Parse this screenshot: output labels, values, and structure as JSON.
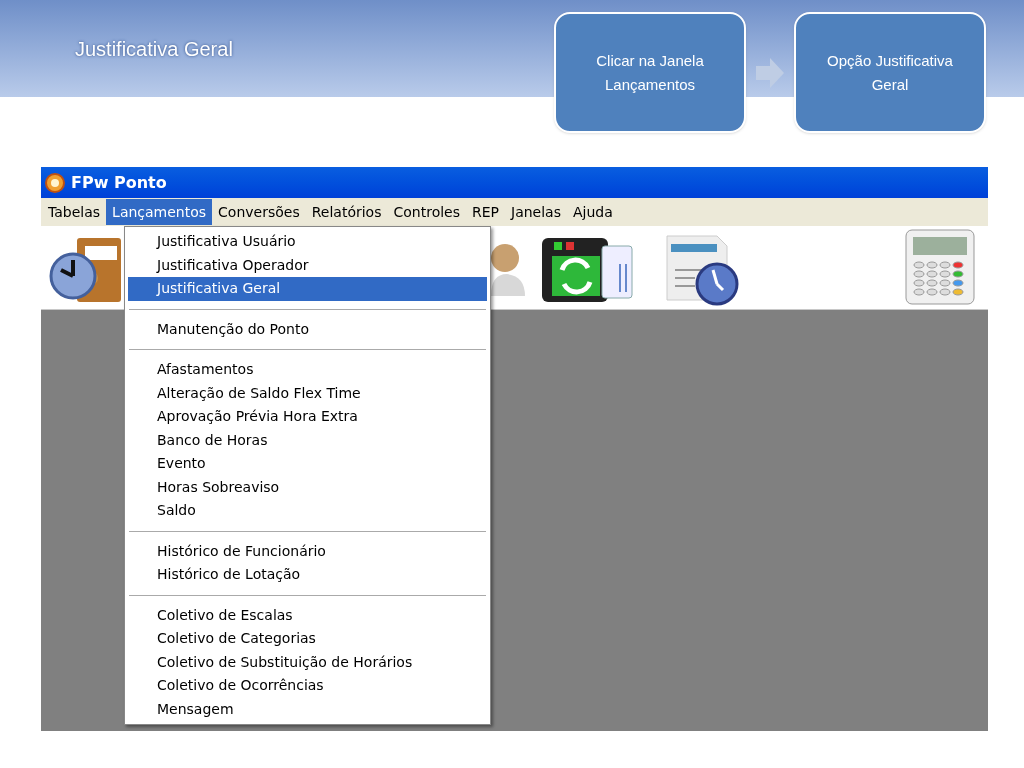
{
  "slide": {
    "title": "Justificativa Geral",
    "steps": [
      {
        "label": "Clicar na Janela Lançamentos"
      },
      {
        "label": "Opção Justificativa Geral"
      }
    ]
  },
  "window": {
    "title": "FPw Ponto",
    "menu_bar": [
      {
        "label": "Tabelas",
        "selected": false
      },
      {
        "label": "Lançamentos",
        "selected": true
      },
      {
        "label": "Conversões",
        "selected": false
      },
      {
        "label": "Relatórios",
        "selected": false
      },
      {
        "label": "Controles",
        "selected": false
      },
      {
        "label": "REP",
        "selected": false
      },
      {
        "label": "Janelas",
        "selected": false
      },
      {
        "label": "Ajuda",
        "selected": false
      }
    ],
    "dropdown": [
      [
        {
          "label": "Justificativa Usuário",
          "selected": false
        },
        {
          "label": "Justificativa Operador",
          "selected": false
        },
        {
          "label": "Justificativa Geral",
          "selected": true
        }
      ],
      [
        {
          "label": "Manutenção do Ponto",
          "selected": false
        }
      ],
      [
        {
          "label": "Afastamentos",
          "selected": false
        },
        {
          "label": "Alteração de Saldo Flex Time",
          "selected": false
        },
        {
          "label": "Aprovação Prévia Hora Extra",
          "selected": false
        },
        {
          "label": "Banco de Horas",
          "selected": false
        },
        {
          "label": "Evento",
          "selected": false
        },
        {
          "label": "Horas Sobreaviso",
          "selected": false
        },
        {
          "label": "Saldo",
          "selected": false
        }
      ],
      [
        {
          "label": "Histórico de Funcionário",
          "selected": false
        },
        {
          "label": "Histórico de Lotação",
          "selected": false
        }
      ],
      [
        {
          "label": "Coletivo de Escalas",
          "selected": false
        },
        {
          "label": "Coletivo de Categorias",
          "selected": false
        },
        {
          "label": "Coletivo de Substituição de Horários",
          "selected": false
        },
        {
          "label": "Coletivo de Ocorrências",
          "selected": false
        },
        {
          "label": "Mensagem",
          "selected": false
        }
      ]
    ]
  }
}
